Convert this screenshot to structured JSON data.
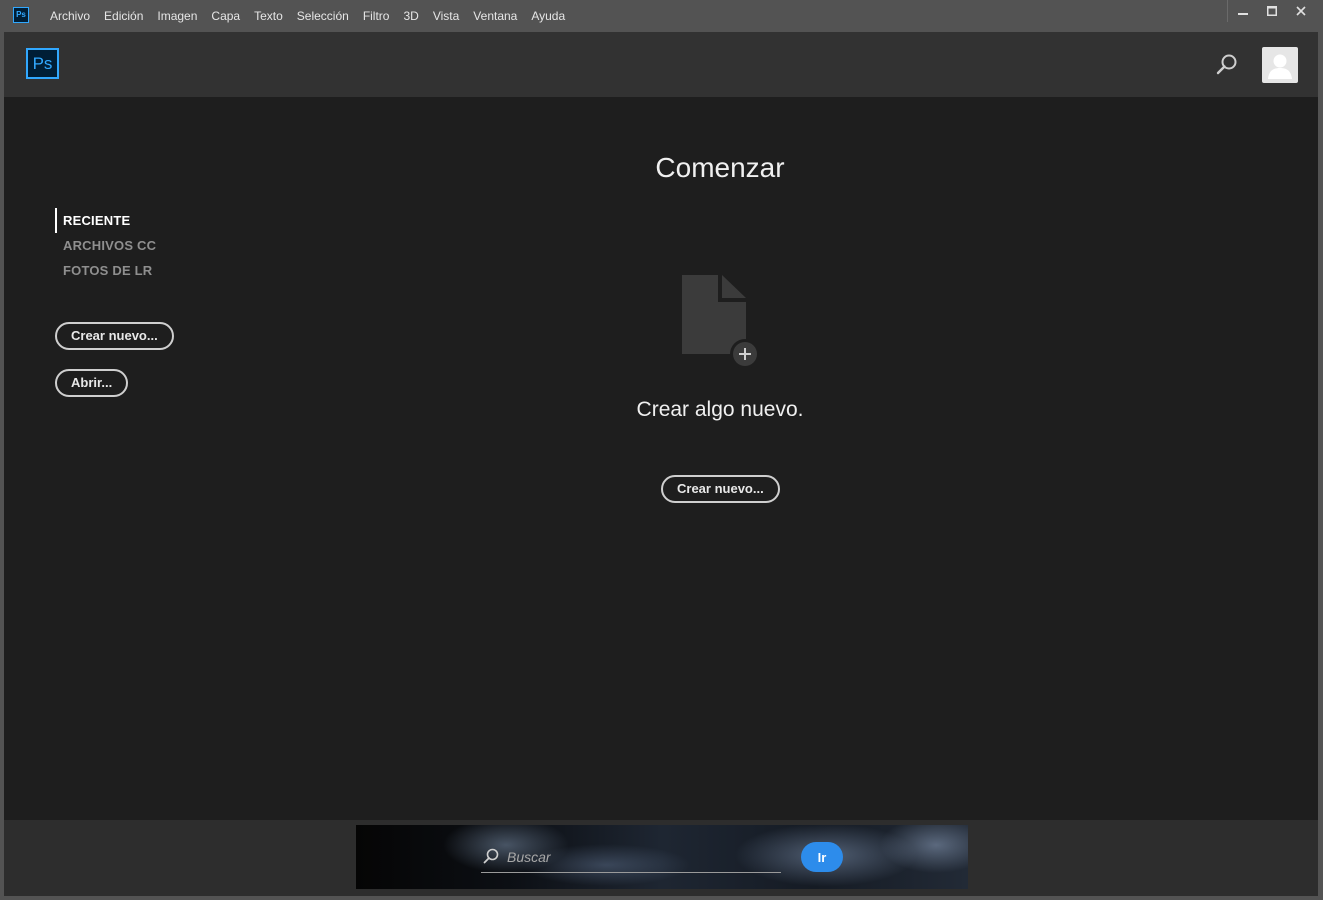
{
  "titlebar": {
    "app_icon_text": "Ps",
    "menu": [
      "Archivo",
      "Edición",
      "Imagen",
      "Capa",
      "Texto",
      "Selección",
      "Filtro",
      "3D",
      "Vista",
      "Ventana",
      "Ayuda"
    ]
  },
  "header": {
    "logo_text": "Ps"
  },
  "sidebar": {
    "nav": [
      {
        "label": "RECIENTE",
        "active": true
      },
      {
        "label": "ARCHIVOS CC",
        "active": false
      },
      {
        "label": "FOTOS DE LR",
        "active": false
      }
    ],
    "create_label": "Crear nuevo...",
    "open_label": "Abrir..."
  },
  "main": {
    "title": "Comenzar",
    "message": "Crear algo nuevo.",
    "create_label": "Crear nuevo..."
  },
  "footer": {
    "search_placeholder": "Buscar",
    "go_label": "Ir"
  },
  "colors": {
    "accent": "#31a8ff",
    "go_button": "#2d8ceb",
    "background": "#1e1e1e",
    "header": "#323232"
  },
  "icons": {
    "search": "search-icon",
    "avatar": "user-avatar-icon",
    "new_document": "new-document-icon",
    "minimize": "minimize-icon",
    "maximize": "maximize-icon",
    "close": "close-icon"
  }
}
